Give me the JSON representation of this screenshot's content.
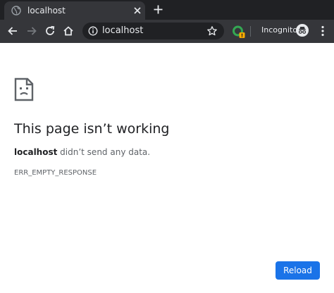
{
  "browser": {
    "tab": {
      "title": "localhost",
      "favicon": "globe-icon",
      "close_icon": "close-icon"
    },
    "new_tab_icon": "plus-icon",
    "toolbar": {
      "back_icon": "arrow-left-icon",
      "forward_icon": "arrow-right-icon",
      "reload_icon": "reload-icon",
      "home_icon": "home-icon",
      "site_info_icon": "info-icon",
      "url": "localhost",
      "bookmark_icon": "star-icon",
      "extension_icon": "extension-icon",
      "profile_label": "Incognito",
      "profile_icon": "incognito-icon",
      "menu_icon": "kebab-menu-icon"
    },
    "colors": {
      "tabstrip_bg": "#202124",
      "toolbar_bg": "#35363a",
      "omnibox_bg": "#202124",
      "text_light": "#e8eaed",
      "extension_green": "#34a853",
      "extension_badge": "#f9ab00"
    }
  },
  "page": {
    "icon": "sad-page-icon",
    "heading": "This page isn’t working",
    "description_host": "localhost",
    "description_rest": " didn’t send any data.",
    "error_code": "ERR_EMPTY_RESPONSE",
    "reload_label": "Reload",
    "colors": {
      "heading": "#202124",
      "body_text": "#5f6368",
      "button_bg": "#1a73e8",
      "button_text": "#ffffff"
    }
  }
}
